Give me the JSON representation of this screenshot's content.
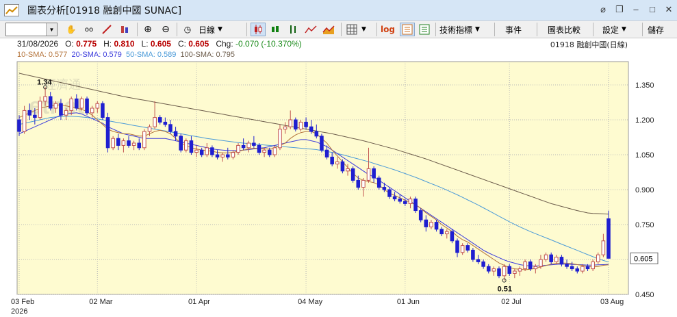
{
  "window": {
    "title": "圖表分析[01918 融創中國 SUNAC]"
  },
  "toolbar": {
    "symbol_value": "",
    "period_label": "日線",
    "log_label": "log",
    "indicators_label": "技術指標",
    "events_label": "事件",
    "compare_label": "圖表比較",
    "settings_label": "設定",
    "save_label": "儲存"
  },
  "info": {
    "date": "31/08/2026",
    "o_label": "O:",
    "o_value": "0.775",
    "h_label": "H:",
    "h_value": "0.810",
    "l_label": "L:",
    "l_value": "0.605",
    "c_label": "C:",
    "c_value": "0.605",
    "chg_label": "Chg:",
    "chg_value": "-0.070 (-10.370%)",
    "code_label": "01918 融創中國(日線)"
  },
  "sma": {
    "sma10": "10-SMA: 0.577",
    "sma20": "20-SMA: 0.579",
    "sma50": "50-SMA: 0.589",
    "sma100": "100-SMA: 0.795"
  },
  "colors": {
    "plot_bg": "#fefbd0",
    "up_candle": "#c0504d",
    "down_candle": "#1f1fd0",
    "sma10": "#b4733a",
    "sma20": "#3a3adc",
    "sma50": "#4a9ad8",
    "sma100": "#6b5b4a",
    "price_tag": "#ffffff"
  },
  "watermark": {
    "line1": "經濟通",
    "line2": "etnet"
  },
  "chart_data": {
    "type": "candlestick",
    "y_ticks": [
      "1.350",
      "1.200",
      "1.050",
      "0.900",
      "0.750",
      "0.600",
      "0.450"
    ],
    "ylim": [
      0.45,
      1.45
    ],
    "x_tick_labels": [
      "03 Feb",
      "02 Mar",
      "01 Apr",
      "04 May",
      "01 Jun",
      "02 Jul",
      "03 Aug"
    ],
    "x_year_label": "2026",
    "last_price_tag": "0.605",
    "annotations": [
      {
        "text": "1.34",
        "value": 1.34
      },
      {
        "text": "0.51",
        "value": 0.51
      }
    ],
    "candles": [
      [
        1.2,
        1.22,
        1.13,
        1.15
      ],
      [
        1.15,
        1.26,
        1.14,
        1.24
      ],
      [
        1.24,
        1.27,
        1.2,
        1.22
      ],
      [
        1.22,
        1.25,
        1.18,
        1.21
      ],
      [
        1.21,
        1.3,
        1.2,
        1.28
      ],
      [
        1.28,
        1.34,
        1.26,
        1.3
      ],
      [
        1.3,
        1.32,
        1.24,
        1.25
      ],
      [
        1.25,
        1.28,
        1.23,
        1.27
      ],
      [
        1.27,
        1.29,
        1.2,
        1.22
      ],
      [
        1.22,
        1.25,
        1.2,
        1.24
      ],
      [
        1.24,
        1.3,
        1.22,
        1.29
      ],
      [
        1.29,
        1.31,
        1.24,
        1.25
      ],
      [
        1.25,
        1.3,
        1.24,
        1.29
      ],
      [
        1.29,
        1.3,
        1.22,
        1.23
      ],
      [
        1.23,
        1.26,
        1.21,
        1.25
      ],
      [
        1.25,
        1.28,
        1.23,
        1.27
      ],
      [
        1.27,
        1.28,
        1.2,
        1.21
      ],
      [
        1.21,
        1.23,
        1.06,
        1.08
      ],
      [
        1.08,
        1.13,
        1.07,
        1.12
      ],
      [
        1.12,
        1.14,
        1.07,
        1.09
      ],
      [
        1.09,
        1.12,
        1.06,
        1.11
      ],
      [
        1.11,
        1.13,
        1.08,
        1.09
      ],
      [
        1.09,
        1.11,
        1.07,
        1.1
      ],
      [
        1.1,
        1.12,
        1.07,
        1.08
      ],
      [
        1.08,
        1.16,
        1.07,
        1.15
      ],
      [
        1.15,
        1.18,
        1.13,
        1.17
      ],
      [
        1.17,
        1.28,
        1.16,
        1.21
      ],
      [
        1.21,
        1.22,
        1.18,
        1.19
      ],
      [
        1.19,
        1.21,
        1.17,
        1.18
      ],
      [
        1.18,
        1.2,
        1.14,
        1.15
      ],
      [
        1.15,
        1.17,
        1.11,
        1.13
      ],
      [
        1.13,
        1.14,
        1.06,
        1.07
      ],
      [
        1.07,
        1.12,
        1.06,
        1.11
      ],
      [
        1.11,
        1.13,
        1.05,
        1.06
      ],
      [
        1.06,
        1.09,
        1.04,
        1.07
      ],
      [
        1.07,
        1.08,
        1.04,
        1.05
      ],
      [
        1.05,
        1.1,
        1.04,
        1.08
      ],
      [
        1.08,
        1.09,
        1.04,
        1.05
      ],
      [
        1.05,
        1.07,
        1.03,
        1.04
      ],
      [
        1.04,
        1.06,
        1.02,
        1.05
      ],
      [
        1.05,
        1.08,
        1.03,
        1.04
      ],
      [
        1.04,
        1.07,
        1.03,
        1.06
      ],
      [
        1.06,
        1.1,
        1.05,
        1.09
      ],
      [
        1.09,
        1.12,
        1.07,
        1.08
      ],
      [
        1.08,
        1.11,
        1.06,
        1.1
      ],
      [
        1.1,
        1.13,
        1.08,
        1.09
      ],
      [
        1.09,
        1.1,
        1.05,
        1.06
      ],
      [
        1.06,
        1.08,
        1.04,
        1.07
      ],
      [
        1.07,
        1.08,
        1.04,
        1.05
      ],
      [
        1.05,
        1.09,
        1.04,
        1.08
      ],
      [
        1.08,
        1.18,
        1.07,
        1.16
      ],
      [
        1.16,
        1.19,
        1.14,
        1.17
      ],
      [
        1.17,
        1.24,
        1.16,
        1.2
      ],
      [
        1.2,
        1.21,
        1.15,
        1.16
      ],
      [
        1.16,
        1.2,
        1.15,
        1.19
      ],
      [
        1.19,
        1.21,
        1.16,
        1.17
      ],
      [
        1.17,
        1.2,
        1.14,
        1.15
      ],
      [
        1.15,
        1.18,
        1.12,
        1.13
      ],
      [
        1.13,
        1.14,
        1.06,
        1.07
      ],
      [
        1.07,
        1.09,
        1.03,
        1.04
      ],
      [
        1.04,
        1.06,
        1.0,
        1.01
      ],
      [
        1.01,
        1.04,
        0.99,
        1.02
      ],
      [
        1.02,
        1.03,
        0.97,
        0.98
      ],
      [
        0.98,
        1.01,
        0.96,
        0.99
      ],
      [
        0.99,
        1.0,
        0.93,
        0.94
      ],
      [
        0.94,
        0.96,
        0.9,
        0.91
      ],
      [
        0.91,
        0.95,
        0.87,
        0.94
      ],
      [
        0.94,
        1.08,
        0.93,
        0.99
      ],
      [
        0.99,
        1.0,
        0.93,
        0.95
      ],
      [
        0.95,
        0.96,
        0.9,
        0.91
      ],
      [
        0.91,
        0.93,
        0.89,
        0.9
      ],
      [
        0.9,
        0.91,
        0.86,
        0.87
      ],
      [
        0.87,
        0.89,
        0.85,
        0.86
      ],
      [
        0.86,
        0.88,
        0.84,
        0.85
      ],
      [
        0.85,
        0.86,
        0.83,
        0.84
      ],
      [
        0.84,
        0.87,
        0.82,
        0.86
      ],
      [
        0.86,
        0.87,
        0.8,
        0.81
      ],
      [
        0.81,
        0.82,
        0.76,
        0.77
      ],
      [
        0.77,
        0.79,
        0.72,
        0.74
      ],
      [
        0.74,
        0.77,
        0.73,
        0.76
      ],
      [
        0.76,
        0.77,
        0.72,
        0.73
      ],
      [
        0.73,
        0.74,
        0.7,
        0.71
      ],
      [
        0.71,
        0.73,
        0.69,
        0.72
      ],
      [
        0.72,
        0.73,
        0.67,
        0.68
      ],
      [
        0.68,
        0.69,
        0.61,
        0.63
      ],
      [
        0.63,
        0.67,
        0.62,
        0.66
      ],
      [
        0.66,
        0.67,
        0.63,
        0.64
      ],
      [
        0.64,
        0.65,
        0.59,
        0.6
      ],
      [
        0.6,
        0.62,
        0.58,
        0.59
      ],
      [
        0.59,
        0.6,
        0.56,
        0.57
      ],
      [
        0.57,
        0.58,
        0.54,
        0.55
      ],
      [
        0.55,
        0.57,
        0.53,
        0.56
      ],
      [
        0.56,
        0.57,
        0.52,
        0.53
      ],
      [
        0.53,
        0.58,
        0.51,
        0.57
      ],
      [
        0.57,
        0.58,
        0.53,
        0.54
      ],
      [
        0.54,
        0.56,
        0.52,
        0.55
      ],
      [
        0.55,
        0.57,
        0.53,
        0.56
      ],
      [
        0.56,
        0.6,
        0.55,
        0.59
      ],
      [
        0.59,
        0.6,
        0.55,
        0.56
      ],
      [
        0.56,
        0.58,
        0.54,
        0.57
      ],
      [
        0.57,
        0.62,
        0.56,
        0.6
      ],
      [
        0.6,
        0.63,
        0.59,
        0.62
      ],
      [
        0.62,
        0.63,
        0.58,
        0.59
      ],
      [
        0.59,
        0.62,
        0.58,
        0.61
      ],
      [
        0.61,
        0.62,
        0.57,
        0.58
      ],
      [
        0.58,
        0.6,
        0.56,
        0.57
      ],
      [
        0.57,
        0.59,
        0.55,
        0.56
      ],
      [
        0.56,
        0.57,
        0.54,
        0.55
      ],
      [
        0.55,
        0.58,
        0.54,
        0.57
      ],
      [
        0.57,
        0.58,
        0.55,
        0.56
      ],
      [
        0.56,
        0.6,
        0.55,
        0.59
      ],
      [
        0.59,
        0.63,
        0.58,
        0.62
      ],
      [
        0.62,
        0.71,
        0.61,
        0.68
      ],
      [
        0.775,
        0.81,
        0.605,
        0.605
      ]
    ],
    "sma10": [
      1.21,
      1.22,
      1.23,
      1.24,
      1.25,
      1.255,
      1.26,
      1.262,
      1.265,
      1.26,
      1.255,
      1.25,
      1.245,
      1.235,
      1.22,
      1.2,
      1.18,
      1.16,
      1.15,
      1.145,
      1.14,
      1.14,
      1.135,
      1.13,
      1.13,
      1.14,
      1.15,
      1.155,
      1.15,
      1.14,
      1.12,
      1.1,
      1.09,
      1.08,
      1.075,
      1.07,
      1.068,
      1.065,
      1.06,
      1.058,
      1.058,
      1.06,
      1.065,
      1.07,
      1.075,
      1.078,
      1.078,
      1.076,
      1.074,
      1.08,
      1.09,
      1.1,
      1.12,
      1.135,
      1.145,
      1.15,
      1.15,
      1.14,
      1.12,
      1.1,
      1.07,
      1.045,
      1.02,
      0.995,
      0.97,
      0.95,
      0.94,
      0.935,
      0.93,
      0.92,
      0.9,
      0.885,
      0.875,
      0.865,
      0.855,
      0.845,
      0.835,
      0.82,
      0.8,
      0.785,
      0.77,
      0.75,
      0.735,
      0.72,
      0.7,
      0.685,
      0.675,
      0.66,
      0.645,
      0.63,
      0.615,
      0.6,
      0.585,
      0.575,
      0.565,
      0.56,
      0.558,
      0.556,
      0.558,
      0.562,
      0.568,
      0.574,
      0.58,
      0.583,
      0.585,
      0.584,
      0.582,
      0.578,
      0.574,
      0.57,
      0.568,
      0.57,
      0.575,
      0.577
    ],
    "sma20": [
      1.14,
      1.15,
      1.16,
      1.17,
      1.18,
      1.19,
      1.2,
      1.21,
      1.22,
      1.225,
      1.228,
      1.23,
      1.225,
      1.215,
      1.205,
      1.195,
      1.185,
      1.17,
      1.16,
      1.15,
      1.14,
      1.135,
      1.13,
      1.125,
      1.12,
      1.12,
      1.12,
      1.12,
      1.12,
      1.115,
      1.11,
      1.105,
      1.1,
      1.095,
      1.09,
      1.085,
      1.08,
      1.075,
      1.072,
      1.07,
      1.068,
      1.068,
      1.068,
      1.07,
      1.072,
      1.075,
      1.078,
      1.08,
      1.085,
      1.09,
      1.095,
      1.1,
      1.105,
      1.11,
      1.115,
      1.115,
      1.11,
      1.105,
      1.095,
      1.085,
      1.07,
      1.055,
      1.04,
      1.025,
      1.01,
      0.995,
      0.98,
      0.965,
      0.955,
      0.94,
      0.925,
      0.91,
      0.895,
      0.88,
      0.865,
      0.85,
      0.835,
      0.82,
      0.805,
      0.79,
      0.775,
      0.76,
      0.745,
      0.73,
      0.715,
      0.7,
      0.685,
      0.67,
      0.655,
      0.64,
      0.628,
      0.618,
      0.608,
      0.598,
      0.59,
      0.584,
      0.578,
      0.574,
      0.572,
      0.572,
      0.573,
      0.575,
      0.577,
      0.579,
      0.58,
      0.58,
      0.579,
      0.578,
      0.577,
      0.576,
      0.576,
      0.577,
      0.578,
      0.579
    ],
    "sma50": [
      1.18,
      1.185,
      1.19,
      1.195,
      1.2,
      1.205,
      1.21,
      1.212,
      1.214,
      1.215,
      1.215,
      1.214,
      1.212,
      1.21,
      1.207,
      1.204,
      1.2,
      1.196,
      1.192,
      1.188,
      1.184,
      1.18,
      1.176,
      1.172,
      1.168,
      1.164,
      1.16,
      1.156,
      1.152,
      1.148,
      1.144,
      1.14,
      1.136,
      1.132,
      1.128,
      1.124,
      1.12,
      1.117,
      1.114,
      1.111,
      1.108,
      1.105,
      1.102,
      1.1,
      1.098,
      1.096,
      1.094,
      1.092,
      1.09,
      1.088,
      1.086,
      1.084,
      1.082,
      1.08,
      1.078,
      1.076,
      1.074,
      1.072,
      1.068,
      1.064,
      1.06,
      1.055,
      1.05,
      1.044,
      1.038,
      1.032,
      1.026,
      1.02,
      1.013,
      1.006,
      0.999,
      0.992,
      0.985,
      0.977,
      0.969,
      0.961,
      0.953,
      0.944,
      0.935,
      0.926,
      0.917,
      0.908,
      0.898,
      0.888,
      0.878,
      0.867,
      0.856,
      0.845,
      0.834,
      0.822,
      0.81,
      0.798,
      0.786,
      0.774,
      0.762,
      0.751,
      0.74,
      0.73,
      0.72,
      0.711,
      0.702,
      0.693,
      0.684,
      0.675,
      0.666,
      0.657,
      0.648,
      0.639,
      0.63,
      0.621,
      0.612,
      0.603,
      0.596,
      0.589
    ],
    "sma100": [
      1.4,
      1.395,
      1.39,
      1.385,
      1.38,
      1.375,
      1.37,
      1.365,
      1.36,
      1.355,
      1.35,
      1.345,
      1.34,
      1.335,
      1.33,
      1.325,
      1.32,
      1.315,
      1.31,
      1.305,
      1.3,
      1.296,
      1.292,
      1.288,
      1.284,
      1.28,
      1.276,
      1.272,
      1.268,
      1.264,
      1.26,
      1.256,
      1.252,
      1.248,
      1.244,
      1.24,
      1.236,
      1.232,
      1.228,
      1.224,
      1.22,
      1.216,
      1.212,
      1.208,
      1.204,
      1.2,
      1.196,
      1.192,
      1.188,
      1.184,
      1.18,
      1.176,
      1.172,
      1.168,
      1.164,
      1.16,
      1.156,
      1.152,
      1.148,
      1.144,
      1.14,
      1.135,
      1.13,
      1.125,
      1.12,
      1.115,
      1.11,
      1.104,
      1.098,
      1.092,
      1.086,
      1.08,
      1.074,
      1.067,
      1.06,
      1.053,
      1.046,
      1.039,
      1.032,
      1.024,
      1.016,
      1.008,
      1.0,
      0.992,
      0.984,
      0.976,
      0.968,
      0.96,
      0.952,
      0.944,
      0.936,
      0.928,
      0.92,
      0.912,
      0.904,
      0.896,
      0.888,
      0.88,
      0.872,
      0.864,
      0.856,
      0.848,
      0.84,
      0.834,
      0.828,
      0.822,
      0.816,
      0.81,
      0.805,
      0.8,
      0.798,
      0.797,
      0.796,
      0.795
    ]
  }
}
